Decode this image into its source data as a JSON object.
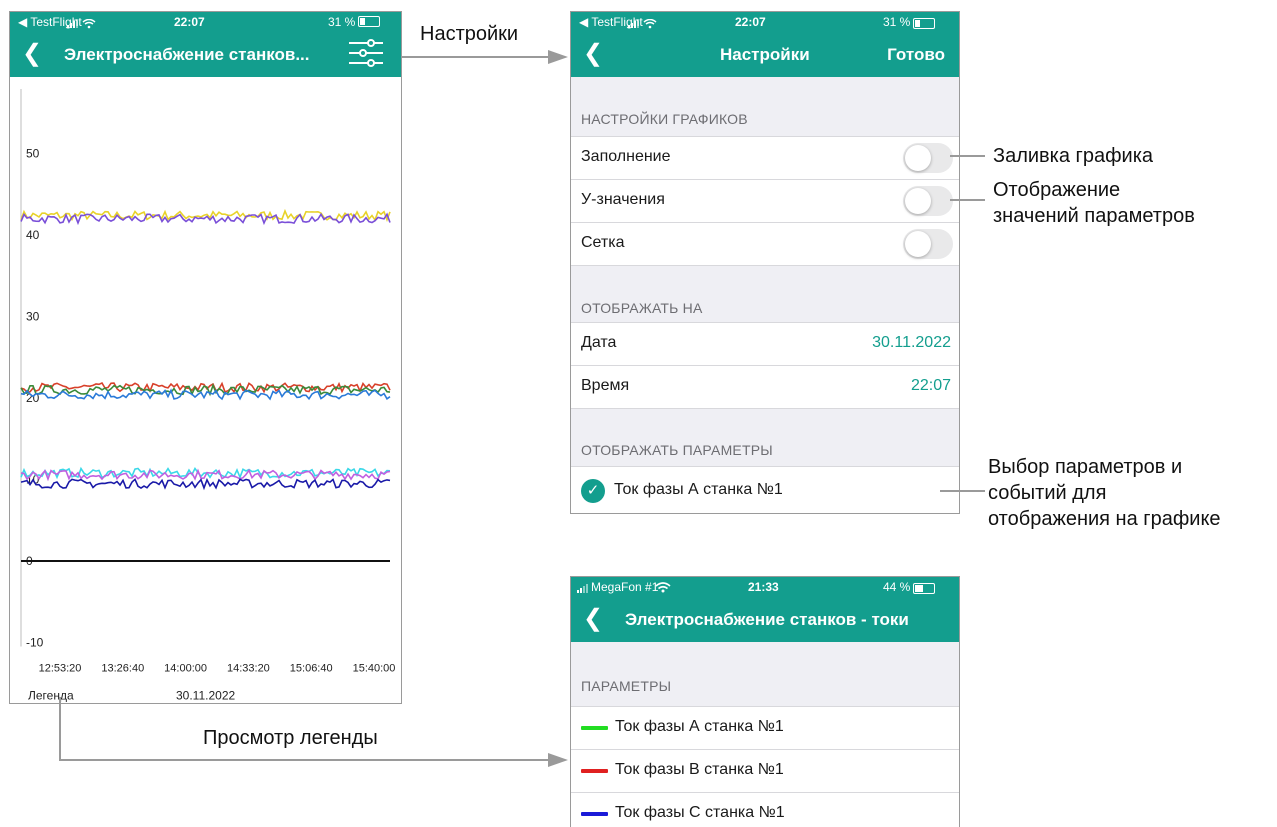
{
  "screen1": {
    "status": {
      "carrier": "◀ TestFlight",
      "time": "22:07",
      "battery": "31 %"
    },
    "title": "Электроснабжение станков...",
    "chart_footer": {
      "legend_label": "Легенда",
      "date": "30.11.2022"
    },
    "chart_data": {
      "type": "line",
      "title": "",
      "xlabel": "",
      "ylabel": "",
      "x_ticks": [
        "12:53:20",
        "13:26:40",
        "14:00:00",
        "14:33:20",
        "15:06:40",
        "15:40:00"
      ],
      "y_ticks": [
        -10,
        0,
        10,
        20,
        30,
        40,
        50
      ],
      "ylim": [
        -10,
        57
      ],
      "grid": false,
      "series": [
        {
          "color": "#e8d22a",
          "level": 42.4
        },
        {
          "color": "#7a4fd8",
          "level": 42.0
        },
        {
          "color": "#d8402a",
          "level": 21.3
        },
        {
          "color": "#3a8a3a",
          "level": 21.0
        },
        {
          "color": "#2a7ad8",
          "level": 20.4
        },
        {
          "color": "#3ad8e8",
          "level": 10.8
        },
        {
          "color": "#c060e0",
          "level": 10.6
        },
        {
          "color": "#1a1aa8",
          "level": 9.5
        },
        {
          "color": "#111111",
          "level": 0.0
        }
      ]
    }
  },
  "screen2": {
    "status": {
      "carrier": "◀ TestFlight",
      "time": "22:07",
      "battery": "31 %"
    },
    "title": "Настройки",
    "done_label": "Готово",
    "sections": {
      "charts_header": "НАСТРОЙКИ ГРАФИКОВ",
      "fill_label": "Заполнение",
      "yvalues_label": "У-значения",
      "grid_label": "Сетка",
      "display_on_header": "ОТОБРАЖАТЬ НА",
      "date_label": "Дата",
      "date_value": "30.11.2022",
      "time_label": "Время",
      "time_value": "22:07",
      "params_header": "ОТОБРАЖАТЬ ПАРАМЕТРЫ",
      "param_checked": "Ток фазы А станка №1"
    }
  },
  "screen3": {
    "status": {
      "carrier": "MegaFon #1",
      "time": "21:33",
      "battery": "44 %"
    },
    "title": "Электроснабжение станков - токи",
    "header": "ПАРАМЕТРЫ",
    "items": [
      {
        "label": "Ток фазы А станка №1",
        "color": "#22dd22"
      },
      {
        "label": "Ток фазы В станка №1",
        "color": "#e02020"
      },
      {
        "label": "Ток фазы С станка №1",
        "color": "#1a1ad8"
      }
    ]
  },
  "annotations": {
    "settings": "Настройки",
    "fill": "Заливка графика",
    "values_line1": "Отображение",
    "values_line2": "значений параметров",
    "choose_line1": "Выбор параметров и",
    "choose_line2": "событий для",
    "choose_line3": "отображения на графике",
    "legend_view": "Просмотр легенды"
  }
}
